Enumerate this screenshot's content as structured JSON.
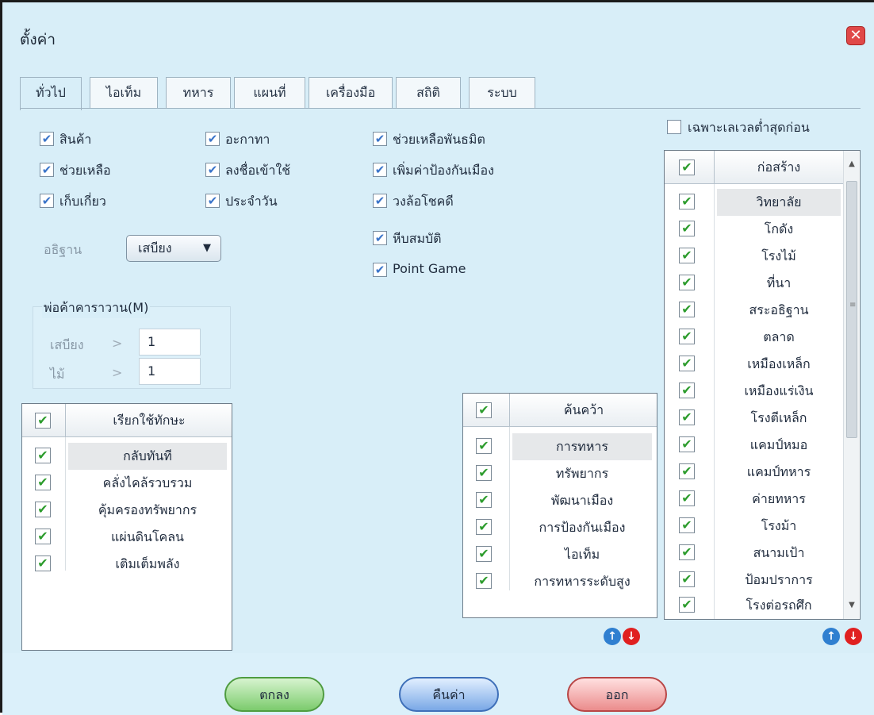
{
  "window": {
    "title": "ตั้งค่า"
  },
  "tabs": [
    {
      "label": "ทั่วไป",
      "active": true
    },
    {
      "label": "ไอเท็ม",
      "active": false
    },
    {
      "label": "ทหาร",
      "active": false
    },
    {
      "label": "แผนที่",
      "active": false
    },
    {
      "label": "เครื่องมือ",
      "active": false
    },
    {
      "label": "สถิติ",
      "active": false
    },
    {
      "label": "ระบบ",
      "active": false
    }
  ],
  "general": {
    "col1": [
      {
        "label": "สินค้า",
        "checked": true
      },
      {
        "label": "ช่วยเหลือ",
        "checked": true
      },
      {
        "label": "เก็บเกี่ยว",
        "checked": true
      }
    ],
    "col2": [
      {
        "label": "อะกาทา",
        "checked": true
      },
      {
        "label": "ลงชื่อเข้าใช้",
        "checked": true
      },
      {
        "label": "ประจำวัน",
        "checked": true
      }
    ],
    "col3": [
      {
        "label": "ช่วยเหลือพันธมิต",
        "checked": true
      },
      {
        "label": "เพิ่มค่าป้องกันเมือง",
        "checked": true
      },
      {
        "label": "วงล้อโชคดี",
        "checked": true
      },
      {
        "label": "หีบสมบัติ",
        "checked": true
      },
      {
        "label": "Point Game",
        "checked": true
      }
    ],
    "wish": {
      "label": "อธิฐาน",
      "selected": "เสบียง"
    },
    "merchant": {
      "title": "พ่อค้าคาราวาน(M)",
      "rows": [
        {
          "label": "เสบียง",
          "op": ">",
          "value": "1"
        },
        {
          "label": "ไม้",
          "op": ">",
          "value": "1"
        }
      ]
    },
    "lowest_level_first": {
      "label": "เฉพาะเลเวลต่ำสุดก่อน",
      "checked": false
    }
  },
  "skills": {
    "header": "เรียกใช้ทักษะ",
    "items": [
      "กลับทันที",
      "คลั่งไคล้รวบรวม",
      "คุ้มครองทรัพยากร",
      "แผ่นดินโคลน",
      "เติมเต็มพลัง"
    ]
  },
  "research": {
    "header": "ค้นคว้า",
    "items": [
      "การทหาร",
      "ทรัพยากร",
      "พัฒนาเมือง",
      "การป้องกันเมือง",
      "ไอเท็ม",
      "การทหารระดับสูง"
    ]
  },
  "build": {
    "header": "ก่อสร้าง",
    "items": [
      "วิทยาลัย",
      "โกดัง",
      "โรงไม้",
      "ที่นา",
      "สระอธิฐาน",
      "ตลาด",
      "เหมืองเหล็ก",
      "เหมืองแร่เงิน",
      "โรงตีเหล็ก",
      "แคมป์หมอ",
      "แคมป์ทหาร",
      "ค่ายทหาร",
      "โรงม้า",
      "สนามเป้า",
      "ป้อมปราการ",
      "โรงต่อรถศึก"
    ]
  },
  "buttons": {
    "ok": "ตกลง",
    "reset": "คืนค่า",
    "exit": "ออก"
  },
  "symbols": {
    "check": "✔",
    "dropdown_arrow": "▼",
    "up": "▲",
    "down": "▼",
    "close": "✕",
    "grip": "≡",
    "move_up": "↑",
    "move_down": "↓"
  },
  "colors": {
    "window_bg": "#d8eef8",
    "check_green": "#2d9c2d",
    "ok_green": "#7ccb6d",
    "reset_blue": "#7aa8e6",
    "exit_red": "#eb8c8c",
    "move_up_blue": "#2f7fd0",
    "move_down_red": "#e02020"
  }
}
